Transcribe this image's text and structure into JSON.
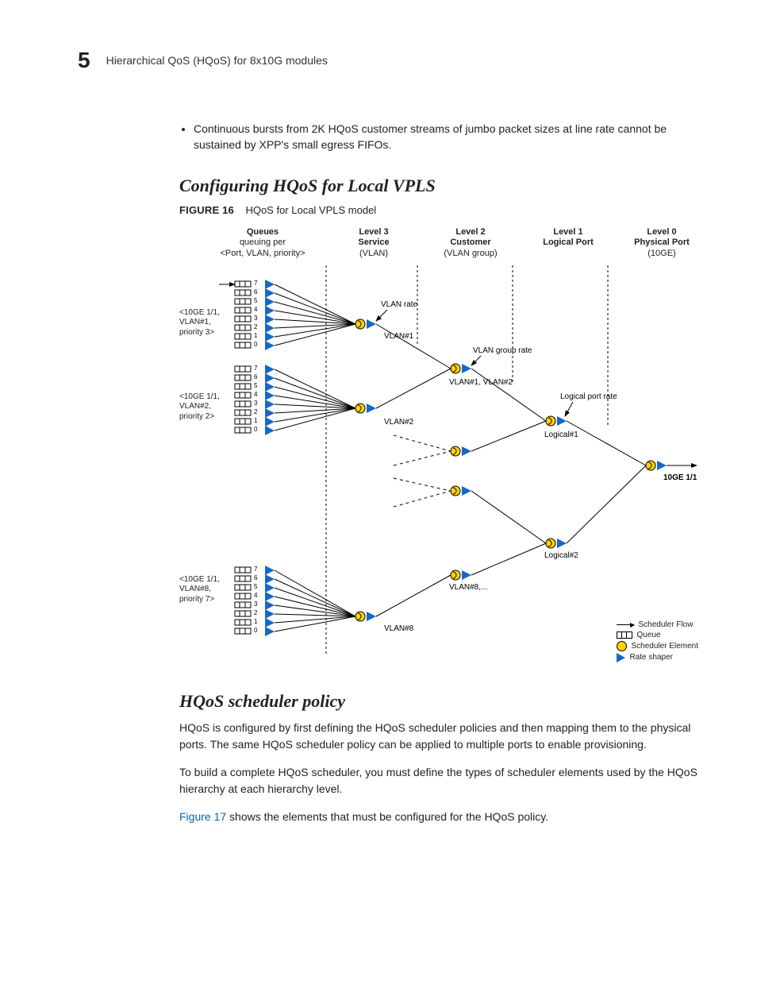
{
  "chapter_number": "5",
  "running_head": "Hierarchical QoS (HQoS) for 8x10G modules",
  "bullet_items": [
    "Continuous bursts from 2K HQoS customer streams of jumbo packet sizes at line rate cannot be sustained by XPP's small egress FIFOs."
  ],
  "section1_title": "Configuring HQoS for Local VPLS",
  "figure": {
    "label": "FIGURE 16",
    "caption": "HQoS for Local VPLS model",
    "columns": [
      {
        "line1": "Queues",
        "line2": "queuing per",
        "line3": "<Port, VLAN, priority>"
      },
      {
        "line1": "Level 3",
        "line2": "Service",
        "line3": "(VLAN)"
      },
      {
        "line1": "Level 2",
        "line2": "Customer",
        "line3": "(VLAN group)"
      },
      {
        "line1": "Level 1",
        "line2": "Logical Port",
        "line3": ""
      },
      {
        "line1": "Level 0",
        "line2": "Physical Port",
        "line3": "(10GE)"
      }
    ],
    "queue_blocks": [
      {
        "label": "<10GE 1/1,\nVLAN#1,\npriority 3>"
      },
      {
        "label": "<10GE 1/1,\nVLAN#2,\npriority 2>"
      },
      {
        "label": "<10GE 1/1,\nVLAN#8,\npriority 7>"
      }
    ],
    "rate_labels": {
      "vlan_rate": "VLAN rate",
      "vlan_group_rate": "VLAN group rate",
      "logical_port_rate": "Logical port rate"
    },
    "node_labels": {
      "vlan1": "VLAN#1",
      "vlan2": "VLAN#2",
      "vlan8": "VLAN#8",
      "vlan12_group": "VLAN#1,\nVLAN#2",
      "vlan8_group": "VLAN#8,...",
      "logical1": "Logical#1",
      "logical2": "Logical#2",
      "port": "10GE 1/1"
    },
    "legend": {
      "flow": "Scheduler Flow",
      "queue": "Queue",
      "element": "Scheduler Element",
      "shaper": "Rate shaper"
    },
    "queue_priorities": [
      "7",
      "6",
      "5",
      "4",
      "3",
      "2",
      "1",
      "0"
    ]
  },
  "section2_title": "HQoS scheduler policy",
  "paragraphs": [
    "HQoS is configured by first defining the HQoS scheduler policies and then mapping them to the physical ports. The same HQoS scheduler policy can be applied to multiple ports to enable provisioning.",
    "To build a complete HQoS scheduler, you must define the types of scheduler elements used by the HQoS hierarchy at each hierarchy level."
  ],
  "xref": {
    "text": "Figure 17",
    "tail": " shows the elements that must be configured for the HQoS policy."
  }
}
